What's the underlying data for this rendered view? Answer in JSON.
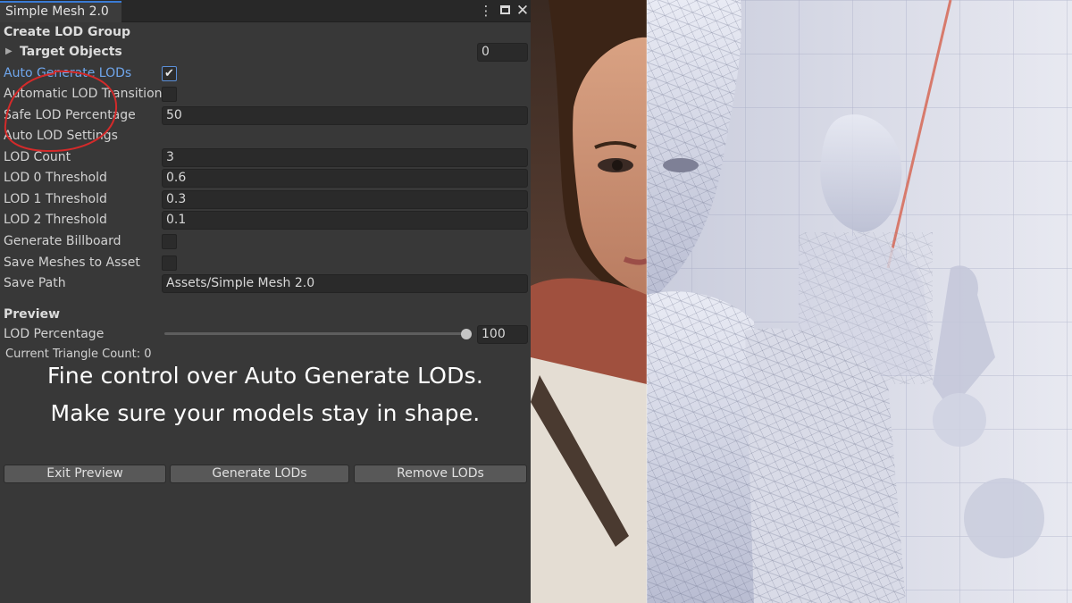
{
  "window": {
    "tab_title": "Simple Mesh 2.0",
    "menu_icon": "kebab-menu-icon",
    "maximize_icon": "maximize-icon",
    "close_icon": "close-icon"
  },
  "create_section": {
    "header": "Create LOD Group",
    "target_objects_label": "Target Objects",
    "target_objects_count": "0"
  },
  "settings": [
    {
      "key": "auto-generate-lods",
      "label": "Auto Generate LODs",
      "type": "checkbox",
      "checked": true,
      "highlight": true
    },
    {
      "key": "automatic-lod-transition",
      "label": "Automatic LOD Transition",
      "type": "checkbox",
      "checked": false
    },
    {
      "key": "safe-lod-percentage",
      "label": "Safe LOD Percentage",
      "type": "field",
      "value": "50"
    },
    {
      "key": "auto-lod-settings",
      "label": "Auto LOD Settings",
      "type": "header"
    },
    {
      "key": "lod-count",
      "label": "LOD Count",
      "type": "field",
      "value": "3"
    },
    {
      "key": "lod-0-threshold",
      "label": "LOD 0 Threshold",
      "type": "field",
      "value": "0.6"
    },
    {
      "key": "lod-1-threshold",
      "label": "LOD 1 Threshold",
      "type": "field",
      "value": "0.3"
    },
    {
      "key": "lod-2-threshold",
      "label": "LOD 2 Threshold",
      "type": "field",
      "value": "0.1"
    },
    {
      "key": "generate-billboard",
      "label": "Generate Billboard",
      "type": "checkbox",
      "checked": false
    },
    {
      "key": "save-meshes-to-asset",
      "label": "Save Meshes to Asset",
      "type": "checkbox",
      "checked": false
    },
    {
      "key": "save-path",
      "label": "Save Path",
      "type": "field",
      "value": "Assets/Simple Mesh 2.0"
    }
  ],
  "preview": {
    "header": "Preview",
    "lod_percentage_label": "LOD Percentage",
    "lod_percentage_value": "100",
    "slider_fraction": 1.0,
    "triangle_count_text": "Current Triangle Count: 0"
  },
  "overlay": {
    "line1": "Fine control over Auto Generate LODs.",
    "line2": "Make sure your models stay in shape."
  },
  "buttons": {
    "exit_preview": "Exit Preview",
    "generate_lods": "Generate LODs",
    "remove_lods": "Remove LODs"
  },
  "colors": {
    "panel_bg": "#383838",
    "accent_blue": "#6fa6ec",
    "annotation_red": "#d42a2a"
  }
}
